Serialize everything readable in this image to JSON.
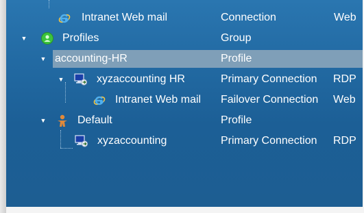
{
  "tree": {
    "rows": [
      {
        "name": "Intranet Web mail",
        "type": "Connection",
        "extra": "Web"
      },
      {
        "name": "Profiles",
        "type": "Group",
        "twist": "▼"
      },
      {
        "name": "accounting-HR",
        "type": "Profile",
        "twist": "▼",
        "selected": true
      },
      {
        "name": "xyzaccounting HR",
        "type": "Primary Connection",
        "extra": "RDP",
        "twist": "▼"
      },
      {
        "name": "Intranet Web mail",
        "type": "Failover Connection",
        "extra": "Web"
      },
      {
        "name": "Default",
        "type": "Profile",
        "twist": "▼"
      },
      {
        "name": "xyzaccounting",
        "type": "Primary Connection",
        "extra": "RDP"
      }
    ]
  },
  "icons": {
    "ie": "internet-explorer-icon",
    "group": "green-group-icon",
    "rdp": "remote-desktop-icon",
    "profile": "orange-person-icon"
  },
  "colors": {
    "panel_top": "#2a76b0",
    "panel_bottom": "#1d5e92",
    "selection": "#7f9fb8",
    "text": "#ffffff"
  }
}
